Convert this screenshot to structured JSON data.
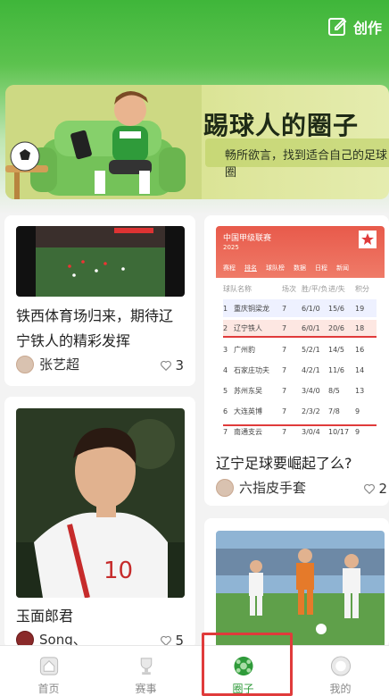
{
  "header": {
    "create_label": "创作"
  },
  "banner": {
    "title": "踢球人的圈子",
    "subtitle": "畅所欲言，找到适合自己的足球圈"
  },
  "posts": [
    {
      "title": "铁西体育场归来，期待辽宁铁人的精彩发挥",
      "author": "张艺超",
      "likes": "3"
    },
    {
      "title": "辽宁足球要崛起了么?",
      "author": "六指皮手套",
      "likes": "2"
    },
    {
      "title": "玉面郎君",
      "author": "Song、",
      "likes": "5"
    }
  ],
  "league_image": {
    "title": "中国甲级联赛",
    "year": "2025",
    "tabs": [
      "赛程",
      "排名",
      "球队榜",
      "数据",
      "日程",
      "新闻"
    ],
    "header_cols": [
      "球队名称",
      "场次",
      "胜/平/负",
      "进/失",
      "积分"
    ],
    "rows": [
      {
        "rank": "1",
        "team": "重庆铜梁龙",
        "played": "7",
        "wdl": "6/1/0",
        "gf": "15/6",
        "pts": "19"
      },
      {
        "rank": "2",
        "team": "辽宁铁人",
        "played": "7",
        "wdl": "6/0/1",
        "gf": "20/6",
        "pts": "18"
      },
      {
        "rank": "3",
        "team": "广州豹",
        "played": "7",
        "wdl": "5/2/1",
        "gf": "14/5",
        "pts": "16"
      },
      {
        "rank": "4",
        "team": "石家庄功夫",
        "played": "7",
        "wdl": "4/2/1",
        "gf": "11/6",
        "pts": "14"
      },
      {
        "rank": "5",
        "team": "苏州东吴",
        "played": "7",
        "wdl": "3/4/0",
        "gf": "8/5",
        "pts": "13"
      },
      {
        "rank": "6",
        "team": "大连英博",
        "played": "7",
        "wdl": "2/3/2",
        "gf": "7/8",
        "pts": "9"
      },
      {
        "rank": "7",
        "team": "南通支云",
        "played": "7",
        "wdl": "3/0/4",
        "gf": "10/17",
        "pts": "9"
      }
    ]
  },
  "tabbar": {
    "items": [
      {
        "label": "首页",
        "icon": "home-icon"
      },
      {
        "label": "赛事",
        "icon": "trophy-icon"
      },
      {
        "label": "圈子",
        "icon": "football-circle-icon"
      },
      {
        "label": "我的",
        "icon": "profile-icon"
      }
    ],
    "active_index": 2
  },
  "colors": {
    "accent": "#2f9b3a",
    "brand_green": "#3fb63a",
    "highlight_red": "#e03b3b"
  }
}
